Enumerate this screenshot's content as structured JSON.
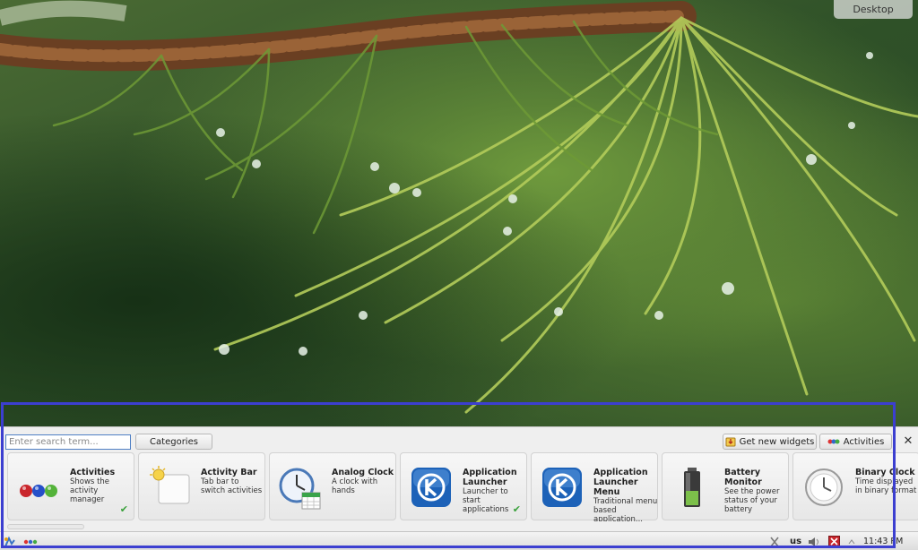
{
  "desktop": {
    "toolbox_label": "Desktop"
  },
  "explorer": {
    "search": {
      "placeholder": "Enter search term..."
    },
    "categories_label": "Categories",
    "get_widgets_label": "Get new widgets",
    "activities_label": "Activities",
    "close_symbol": "✕",
    "widgets": [
      {
        "title": "Activities",
        "desc": "Shows the activity manager",
        "icon": "three-balls-icon",
        "installed": true
      },
      {
        "title": "Activity Bar",
        "desc": "Tab bar to switch activities",
        "icon": "activity-bar-icon",
        "installed": false
      },
      {
        "title": "Analog Clock",
        "desc": "A clock with hands",
        "icon": "analog-clock-icon",
        "installed": false
      },
      {
        "title": "Application Launcher",
        "desc": "Launcher to start applications",
        "icon": "kde-logo-icon",
        "installed": true
      },
      {
        "title": "Application Launcher Menu",
        "desc": "Traditional menu based application...",
        "icon": "kde-logo-icon",
        "installed": false
      },
      {
        "title": "Battery Monitor",
        "desc": "See the power status of your battery",
        "icon": "battery-icon",
        "installed": false
      },
      {
        "title": "Binary Clock",
        "desc": "Time displayed in binary format",
        "icon": "clock-icon",
        "installed": false
      }
    ],
    "installed_check": "✔"
  },
  "panel": {
    "keyboard_layout": "us",
    "clock": "11:43 PM"
  },
  "colors": {
    "selection": "#3c3fd0",
    "search_border": "#4f7fc4",
    "check": "#39a03a"
  }
}
